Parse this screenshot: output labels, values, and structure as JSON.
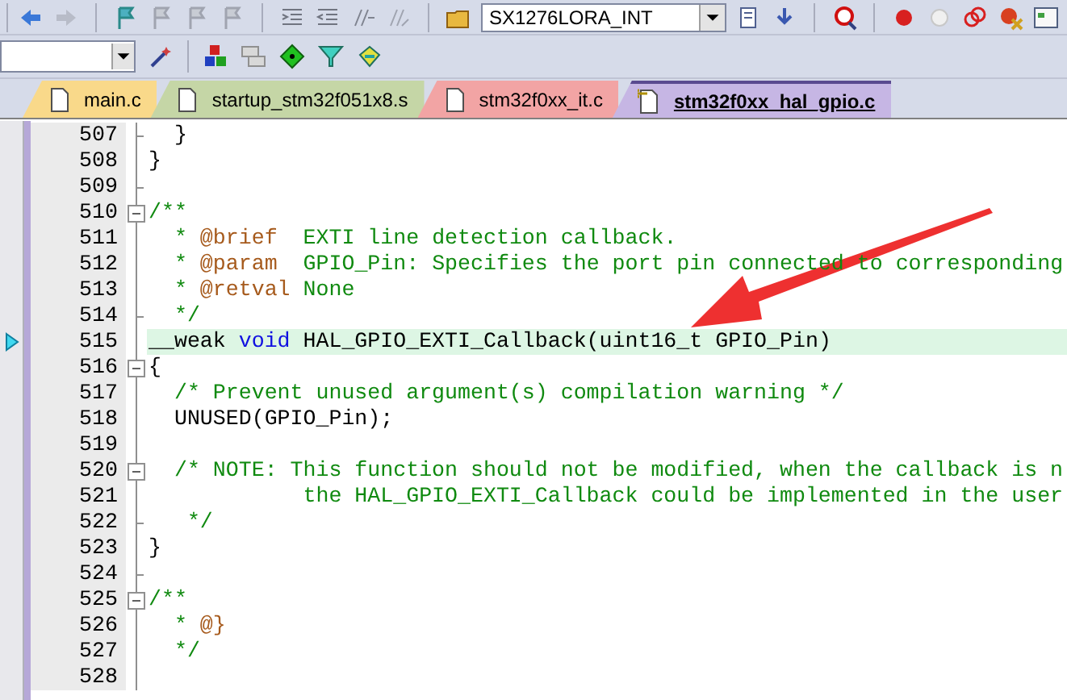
{
  "toolbar": {
    "target": "SX1276LORA_INT"
  },
  "tabs": [
    {
      "label": "main.c",
      "selected": false,
      "color": "#f9d98a"
    },
    {
      "label": "startup_stm32f051x8.s",
      "selected": false,
      "color": "#c5d6a6"
    },
    {
      "label": "stm32f0xx_it.c",
      "selected": false,
      "color": "#f2a4a4"
    },
    {
      "label": "stm32f0xx_hal_gpio.c",
      "selected": true,
      "color": "#c6b6e4"
    }
  ],
  "editor": {
    "lines": [
      {
        "number": "507",
        "collapsible": false,
        "block_end": true,
        "current": false,
        "tokens": [
          {
            "kind": "plain",
            "text": "  }"
          }
        ]
      },
      {
        "number": "508",
        "collapsible": false,
        "block_end": false,
        "current": false,
        "tokens": [
          {
            "kind": "plain",
            "text": "}"
          }
        ]
      },
      {
        "number": "509",
        "collapsible": false,
        "block_end": true,
        "current": false
      },
      {
        "number": "510",
        "collapsible": true,
        "block_end": false,
        "current": false,
        "tokens": [
          {
            "kind": "comment",
            "text": "/**"
          }
        ]
      },
      {
        "number": "511",
        "collapsible": false,
        "block_end": false,
        "current": false,
        "tokens": [
          {
            "kind": "comment",
            "text": "  * "
          },
          {
            "kind": "tag",
            "text": "@brief"
          },
          {
            "kind": "comment",
            "text": "  EXTI line detection callback."
          }
        ]
      },
      {
        "number": "512",
        "collapsible": false,
        "block_end": false,
        "current": false,
        "tokens": [
          {
            "kind": "comment",
            "text": "  * "
          },
          {
            "kind": "tag",
            "text": "@param"
          },
          {
            "kind": "comment",
            "text": "  GPIO_Pin: Specifies the port pin connected to corresponding"
          }
        ]
      },
      {
        "number": "513",
        "collapsible": false,
        "block_end": false,
        "current": false,
        "tokens": [
          {
            "kind": "comment",
            "text": "  * "
          },
          {
            "kind": "tag",
            "text": "@retval"
          },
          {
            "kind": "comment",
            "text": " None"
          }
        ]
      },
      {
        "number": "514",
        "collapsible": false,
        "block_end": true,
        "current": false,
        "tokens": [
          {
            "kind": "comment",
            "text": "  */"
          }
        ]
      },
      {
        "number": "515",
        "collapsible": false,
        "block_end": false,
        "current": true,
        "tokens": [
          {
            "kind": "plain",
            "text": "__weak "
          },
          {
            "kind": "keyword",
            "text": "void"
          },
          {
            "kind": "plain",
            "text": " HAL_GPIO_EXTI_Callback(uint16_t GPIO_Pin)"
          }
        ]
      },
      {
        "number": "516",
        "collapsible": true,
        "block_end": false,
        "current": false,
        "tokens": [
          {
            "kind": "plain",
            "text": "{"
          }
        ]
      },
      {
        "number": "517",
        "collapsible": false,
        "block_end": false,
        "current": false,
        "tokens": [
          {
            "kind": "comment",
            "text": "  /* Prevent unused argument(s) compilation warning */"
          }
        ]
      },
      {
        "number": "518",
        "collapsible": false,
        "block_end": false,
        "current": false,
        "tokens": [
          {
            "kind": "plain",
            "text": "  UNUSED(GPIO_Pin);"
          }
        ]
      },
      {
        "number": "519",
        "collapsible": false,
        "block_end": false,
        "current": false
      },
      {
        "number": "520",
        "collapsible": true,
        "block_end": false,
        "current": false,
        "tokens": [
          {
            "kind": "comment",
            "text": "  /* NOTE: This function should not be modified, when the callback is n"
          }
        ]
      },
      {
        "number": "521",
        "collapsible": false,
        "block_end": false,
        "current": false,
        "tokens": [
          {
            "kind": "comment",
            "text": "            the HAL_GPIO_EXTI_Callback could be implemented in the user"
          }
        ]
      },
      {
        "number": "522",
        "collapsible": false,
        "block_end": true,
        "current": false,
        "tokens": [
          {
            "kind": "comment",
            "text": "   */"
          }
        ]
      },
      {
        "number": "523",
        "collapsible": false,
        "block_end": false,
        "current": false,
        "tokens": [
          {
            "kind": "plain",
            "text": "}"
          }
        ]
      },
      {
        "number": "524",
        "collapsible": false,
        "block_end": true,
        "current": false
      },
      {
        "number": "525",
        "collapsible": true,
        "block_end": false,
        "current": false,
        "tokens": [
          {
            "kind": "comment",
            "text": "/**"
          }
        ]
      },
      {
        "number": "526",
        "collapsible": false,
        "block_end": false,
        "current": false,
        "tokens": [
          {
            "kind": "comment",
            "text": "  * "
          },
          {
            "kind": "tag",
            "text": "@}"
          }
        ]
      },
      {
        "number": "527",
        "collapsible": false,
        "block_end": false,
        "current": false,
        "tokens": [
          {
            "kind": "comment",
            "text": "  */"
          }
        ]
      },
      {
        "number": "528",
        "collapsible": false,
        "block_end": false,
        "current": false
      }
    ]
  }
}
